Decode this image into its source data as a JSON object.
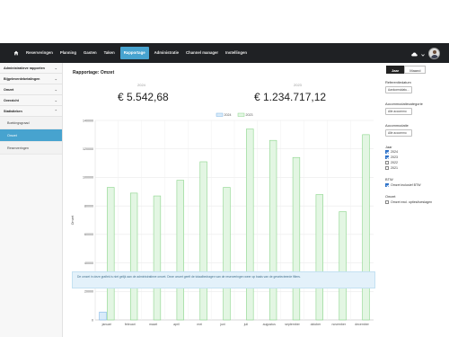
{
  "nav": {
    "items": [
      "Reserveringen",
      "Planning",
      "Gasten",
      "Taken",
      "Rapportage",
      "Administratie",
      "Channel manager",
      "Instellingen"
    ],
    "active": "Rapportage"
  },
  "sidebar": {
    "items": [
      {
        "label": "Administratieve rapporten"
      },
      {
        "label": "Bijgeleverdebetalingen"
      },
      {
        "label": "Omzet"
      },
      {
        "label": "Overzicht"
      },
      {
        "label": "Statistieken"
      }
    ],
    "subitems": [
      {
        "label": "Boekingsgraad"
      },
      {
        "label": "Omzet"
      },
      {
        "label": "Reserveringen"
      }
    ]
  },
  "main": {
    "title": "Rapportage: Omzet",
    "years": [
      {
        "year": "2024",
        "total": "€ 5.542,68"
      },
      {
        "year": "2023",
        "total": "€ 1.234.717,12"
      }
    ],
    "info": "De omzet in deze grafiek is niet gelijk aan de administratieve omzet. Deze omzet geeft de totaalbedragen van de reserveringen weer op basis van de geselecteerde filters."
  },
  "chart_data": {
    "type": "bar",
    "categories": [
      "januari",
      "februari",
      "maart",
      "april",
      "mei",
      "juni",
      "juli",
      "augustus",
      "september",
      "oktober",
      "november",
      "december"
    ],
    "series": [
      {
        "name": "2024",
        "color": "#7fb6e6",
        "values": [
          5542.68,
          0,
          0,
          0,
          0,
          0,
          0,
          0,
          0,
          0,
          0,
          0
        ]
      },
      {
        "name": "2023",
        "color": "#8bd58b",
        "values": [
          93000,
          89000,
          87000,
          98000,
          111000,
          93000,
          134000,
          126000,
          114000,
          88000,
          76000,
          130000
        ]
      }
    ],
    "ylabel": "Omzet",
    "ylim": [
      0,
      140000
    ],
    "yticks": [
      "0",
      "20000",
      "40000",
      "60000",
      "80000",
      "100000",
      "120000",
      "140000"
    ],
    "grid": true,
    "legend": "top-center"
  },
  "filters": {
    "toggle": [
      "Jaar",
      "Maand"
    ],
    "toggle_active": "Jaar",
    "ref_label": "Referentiedatum",
    "ref_value": "Aankomstdatu...",
    "cat_label": "Accommodatiecategorie",
    "cat_value": "Alle accommo",
    "acc_label": "Accommodatie",
    "acc_value": "Alle accommo",
    "year_label": "Jaar",
    "years": [
      {
        "label": "2024",
        "checked": true
      },
      {
        "label": "2023",
        "checked": true
      },
      {
        "label": "2022",
        "checked": false
      },
      {
        "label": "2021",
        "checked": false
      }
    ],
    "btw_label": "BTW",
    "btw_option": "Omzet inclusief BTW",
    "btw_checked": true,
    "omzet_label": "Omzet",
    "omzet_option": "Omzet excl. opties/toeslagen",
    "omzet_checked": false
  },
  "icons": {
    "home": "home-icon",
    "cloud": "cloud-icon",
    "user_menu": "chevron-down-icon"
  }
}
